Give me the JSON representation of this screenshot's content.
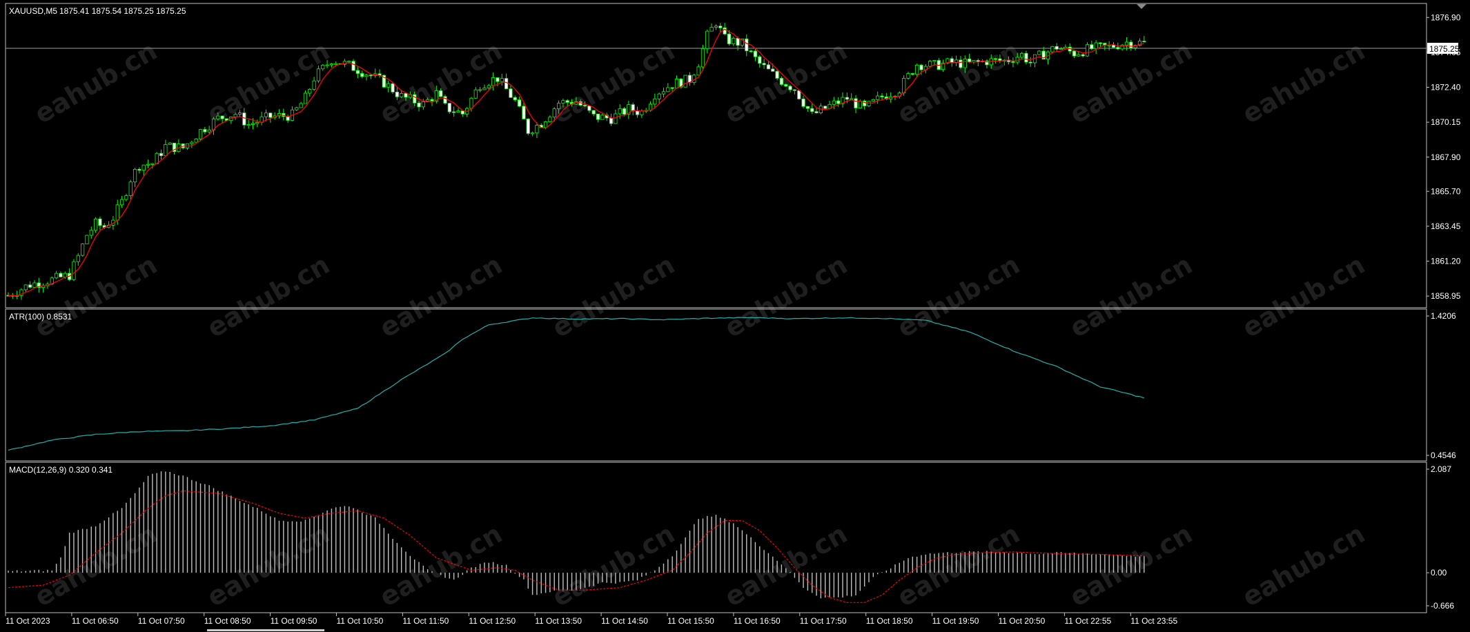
{
  "symbol_label": "XAUUSD,M5",
  "ohlc_label": "1875.41 1875.54 1875.25 1875.25",
  "current_price": "1875.25",
  "watermark": "eahub.cn",
  "colors": {
    "bull": "#00ff00",
    "bear": "#00ff00",
    "bull_fill": "#000000",
    "bear_fill": "#ffffff",
    "ma": "#ff0000",
    "atr": "#20b2aa",
    "macd_hist": "#c0c0c0",
    "macd_signal": "#ff0000",
    "grid_border": "#c0c0c0"
  },
  "chart_data": [
    {
      "type": "candlestick",
      "title": "XAUUSD,M5",
      "ylim": [
        1858.2,
        1877.8
      ],
      "yticks": [
        "1876.90",
        "1874.65",
        "1872.40",
        "1870.15",
        "1867.90",
        "1865.70",
        "1863.45",
        "1861.20",
        "1858.95"
      ],
      "ytick_values": [
        1876.9,
        1874.65,
        1872.4,
        1870.15,
        1867.9,
        1865.7,
        1863.45,
        1861.2,
        1858.95
      ],
      "current": 1875.25,
      "close_path": [
        [
          0,
          1859.0
        ],
        [
          5,
          1859.7
        ],
        [
          10,
          1860.0
        ],
        [
          14,
          1860.3
        ],
        [
          16,
          1861.5
        ],
        [
          18,
          1862.9
        ],
        [
          20,
          1863.6
        ],
        [
          22,
          1863.4
        ],
        [
          24,
          1864.0
        ],
        [
          26,
          1865.0
        ],
        [
          28,
          1866.5
        ],
        [
          30,
          1867.4
        ],
        [
          33,
          1867.5
        ],
        [
          36,
          1868.6
        ],
        [
          40,
          1868.5
        ],
        [
          44,
          1869.6
        ],
        [
          48,
          1870.4
        ],
        [
          52,
          1870.7
        ],
        [
          55,
          1870.0
        ],
        [
          60,
          1870.5
        ],
        [
          65,
          1870.6
        ],
        [
          68,
          1871.7
        ],
        [
          70,
          1873.0
        ],
        [
          74,
          1874.2
        ],
        [
          78,
          1873.8
        ],
        [
          82,
          1873.3
        ],
        [
          86,
          1872.7
        ],
        [
          90,
          1871.8
        ],
        [
          95,
          1871.3
        ],
        [
          98,
          1872.0
        ],
        [
          100,
          1871.1
        ],
        [
          104,
          1870.7
        ],
        [
          108,
          1872.6
        ],
        [
          112,
          1873.0
        ],
        [
          116,
          1871.5
        ],
        [
          119,
          1869.6
        ],
        [
          122,
          1870.1
        ],
        [
          126,
          1871.4
        ],
        [
          130,
          1871.5
        ],
        [
          134,
          1870.5
        ],
        [
          138,
          1870.4
        ],
        [
          142,
          1871.0
        ],
        [
          145,
          1870.8
        ],
        [
          148,
          1872.0
        ],
        [
          152,
          1872.6
        ],
        [
          156,
          1872.9
        ],
        [
          158,
          1874.0
        ],
        [
          160,
          1875.7
        ],
        [
          162,
          1876.6
        ],
        [
          164,
          1875.5
        ],
        [
          168,
          1875.2
        ],
        [
          172,
          1873.9
        ],
        [
          176,
          1873.0
        ],
        [
          180,
          1872.3
        ],
        [
          184,
          1870.6
        ],
        [
          188,
          1871.2
        ],
        [
          192,
          1871.7
        ],
        [
          196,
          1871.0
        ],
        [
          200,
          1871.8
        ],
        [
          204,
          1872.3
        ],
        [
          208,
          1873.9
        ],
        [
          212,
          1873.8
        ],
        [
          216,
          1874.0
        ],
        [
          220,
          1873.9
        ],
        [
          224,
          1874.1
        ],
        [
          228,
          1874.1
        ],
        [
          232,
          1874.5
        ],
        [
          234,
          1874.0
        ],
        [
          236,
          1874.4
        ],
        [
          240,
          1875.0
        ],
        [
          244,
          1874.6
        ],
        [
          248,
          1874.9
        ],
        [
          252,
          1875.0
        ],
        [
          256,
          1875.3
        ],
        [
          260,
          1875.25
        ]
      ],
      "bars": 261,
      "ma_label": ""
    },
    {
      "type": "line",
      "title": "ATR(100) 0.8531",
      "ylim": [
        0.4546,
        1.4206
      ],
      "yticks": [
        "1.4206",
        "0.4546"
      ],
      "ytick_values": [
        1.4206,
        0.4546
      ],
      "x": [
        0,
        10,
        20,
        30,
        40,
        50,
        60,
        70,
        80,
        90,
        100,
        104,
        110,
        120,
        130,
        140,
        150,
        160,
        170,
        180,
        190,
        200,
        210,
        220,
        230,
        240,
        250,
        260
      ],
      "values": [
        0.49,
        0.56,
        0.6,
        0.62,
        0.625,
        0.64,
        0.66,
        0.7,
        0.78,
        0.98,
        1.16,
        1.26,
        1.36,
        1.408,
        1.4,
        1.402,
        1.395,
        1.405,
        1.41,
        1.402,
        1.408,
        1.405,
        1.39,
        1.31,
        1.18,
        1.07,
        0.93,
        0.8531
      ]
    },
    {
      "type": "bar",
      "title": "MACD(12,26,9) 0.320 0.341",
      "ylim": [
        -0.666,
        2.087
      ],
      "yticks": [
        "2.087",
        "0.00",
        "-0.666"
      ],
      "ytick_values": [
        2.087,
        0.0,
        -0.666
      ],
      "hist": [
        [
          0,
          0.03
        ],
        [
          10,
          0.05
        ],
        [
          12,
          0.3
        ],
        [
          14,
          0.8
        ],
        [
          20,
          0.95
        ],
        [
          26,
          1.3
        ],
        [
          30,
          1.7
        ],
        [
          32,
          1.95
        ],
        [
          36,
          2.05
        ],
        [
          40,
          1.95
        ],
        [
          46,
          1.75
        ],
        [
          52,
          1.5
        ],
        [
          58,
          1.25
        ],
        [
          62,
          1.05
        ],
        [
          68,
          1.05
        ],
        [
          74,
          1.3
        ],
        [
          78,
          1.35
        ],
        [
          84,
          1.1
        ],
        [
          88,
          0.7
        ],
        [
          92,
          0.35
        ],
        [
          96,
          0.05
        ],
        [
          102,
          -0.15
        ],
        [
          106,
          0.1
        ],
        [
          110,
          0.22
        ],
        [
          114,
          0.15
        ],
        [
          118,
          -0.15
        ],
        [
          120,
          -0.45
        ],
        [
          124,
          -0.38
        ],
        [
          130,
          -0.35
        ],
        [
          136,
          -0.2
        ],
        [
          140,
          -0.2
        ],
        [
          144,
          -0.15
        ],
        [
          148,
          0.05
        ],
        [
          152,
          0.35
        ],
        [
          155,
          0.7
        ],
        [
          158,
          1.1
        ],
        [
          162,
          1.15
        ],
        [
          166,
          1.0
        ],
        [
          170,
          0.7
        ],
        [
          174,
          0.4
        ],
        [
          178,
          0.1
        ],
        [
          182,
          -0.3
        ],
        [
          186,
          -0.5
        ],
        [
          190,
          -0.5
        ],
        [
          194,
          -0.45
        ],
        [
          198,
          -0.1
        ],
        [
          202,
          0.1
        ],
        [
          206,
          0.3
        ],
        [
          210,
          0.38
        ],
        [
          214,
          0.4
        ],
        [
          220,
          0.42
        ],
        [
          226,
          0.42
        ],
        [
          232,
          0.4
        ],
        [
          236,
          0.38
        ],
        [
          240,
          0.4
        ],
        [
          246,
          0.39
        ],
        [
          252,
          0.37
        ],
        [
          256,
          0.35
        ],
        [
          260,
          0.32
        ]
      ],
      "signal": [
        [
          0,
          -0.3
        ],
        [
          8,
          -0.25
        ],
        [
          14,
          -0.05
        ],
        [
          20,
          0.4
        ],
        [
          26,
          0.8
        ],
        [
          32,
          1.3
        ],
        [
          36,
          1.55
        ],
        [
          40,
          1.65
        ],
        [
          48,
          1.6
        ],
        [
          56,
          1.4
        ],
        [
          62,
          1.2
        ],
        [
          68,
          1.1
        ],
        [
          74,
          1.2
        ],
        [
          80,
          1.25
        ],
        [
          86,
          1.1
        ],
        [
          92,
          0.75
        ],
        [
          98,
          0.3
        ],
        [
          106,
          0.05
        ],
        [
          112,
          0.1
        ],
        [
          116,
          0.05
        ],
        [
          120,
          -0.15
        ],
        [
          126,
          -0.35
        ],
        [
          132,
          -0.35
        ],
        [
          140,
          -0.3
        ],
        [
          146,
          -0.15
        ],
        [
          152,
          0.05
        ],
        [
          156,
          0.4
        ],
        [
          160,
          0.8
        ],
        [
          164,
          1.05
        ],
        [
          168,
          1.05
        ],
        [
          172,
          0.85
        ],
        [
          176,
          0.5
        ],
        [
          180,
          0.1
        ],
        [
          184,
          -0.25
        ],
        [
          188,
          -0.5
        ],
        [
          192,
          -0.6
        ],
        [
          196,
          -0.6
        ],
        [
          200,
          -0.45
        ],
        [
          204,
          -0.15
        ],
        [
          208,
          0.1
        ],
        [
          212,
          0.28
        ],
        [
          216,
          0.36
        ],
        [
          222,
          0.4
        ],
        [
          230,
          0.42
        ],
        [
          236,
          0.4
        ],
        [
          242,
          0.38
        ],
        [
          250,
          0.37
        ],
        [
          256,
          0.35
        ],
        [
          260,
          0.341
        ]
      ]
    }
  ],
  "x_ticks": [
    "11 Oct 2023",
    "11 Oct 06:50",
    "11 Oct 07:50",
    "11 Oct 08:50",
    "11 Oct 09:50",
    "11 Oct 10:50",
    "11 Oct 11:50",
    "11 Oct 12:50",
    "11 Oct 13:50",
    "11 Oct 14:50",
    "11 Oct 15:50",
    "11 Oct 16:50",
    "11 Oct 17:50",
    "11 Oct 18:50",
    "11 Oct 19:50",
    "11 Oct 20:50",
    "11 Oct 22:55",
    "11 Oct 23:55"
  ],
  "x_tick_bars": [
    0,
    12,
    24,
    36,
    48,
    60,
    72,
    84,
    96,
    108,
    120,
    132,
    144,
    156,
    168,
    180,
    192,
    204
  ]
}
